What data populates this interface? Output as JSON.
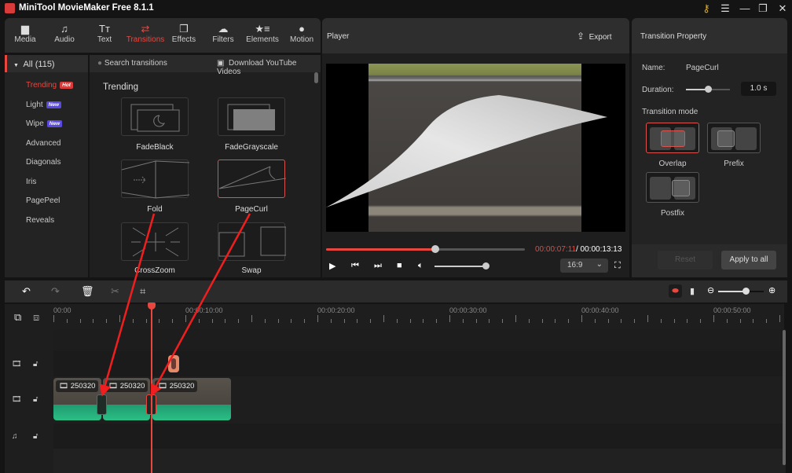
{
  "app": {
    "title": "MiniTool MovieMaker Free 8.1.1"
  },
  "window_controls": [
    {
      "name": "key-icon",
      "glyph": "⚷"
    },
    {
      "name": "menu-icon",
      "glyph": "☰"
    },
    {
      "name": "minimize-icon",
      "glyph": "—"
    },
    {
      "name": "restore-icon",
      "glyph": "❐"
    },
    {
      "name": "close-icon",
      "glyph": "✕"
    }
  ],
  "toolbar": {
    "tabs": [
      {
        "label": "Media",
        "icon": "folder-icon",
        "glyph": "▆"
      },
      {
        "label": "Audio",
        "icon": "music-icon",
        "glyph": "♫"
      },
      {
        "label": "Text",
        "icon": "text-icon",
        "glyph": "Tт"
      },
      {
        "label": "Transitions",
        "icon": "transitions-icon",
        "glyph": "⇄",
        "active": true
      },
      {
        "label": "Effects",
        "icon": "effects-icon",
        "glyph": "❐"
      },
      {
        "label": "Filters",
        "icon": "filters-icon",
        "glyph": "☁"
      },
      {
        "label": "Elements",
        "icon": "elements-icon",
        "glyph": "★≡"
      },
      {
        "label": "Motion",
        "icon": "motion-icon",
        "glyph": "●"
      }
    ]
  },
  "categories": {
    "all_label": "All (115)",
    "items": [
      {
        "label": "Trending",
        "badge": "Hot",
        "active": true
      },
      {
        "label": "Light",
        "badge": "New"
      },
      {
        "label": "Wipe",
        "badge": "New"
      },
      {
        "label": "Advanced"
      },
      {
        "label": "Diagonals"
      },
      {
        "label": "Iris"
      },
      {
        "label": "PagePeel"
      },
      {
        "label": "Reveals"
      }
    ]
  },
  "library": {
    "search_placeholder": "Search transitions",
    "download_label": "Download YouTube Videos",
    "section_title": "Trending",
    "items": [
      {
        "label": "FadeBlack"
      },
      {
        "label": "FadeGrayscale"
      },
      {
        "label": "Fold"
      },
      {
        "label": "PageCurl",
        "selected": true
      },
      {
        "label": "CrossZoom"
      },
      {
        "label": "Swap"
      }
    ]
  },
  "player": {
    "title": "Player",
    "export_label": "Export",
    "current_time": "00:00:07:11",
    "total_time": "/ 00:00:13:13",
    "progress_fraction": 0.55,
    "volume_fraction": 1.0,
    "aspect_ratio": "16:9"
  },
  "property": {
    "title": "Transition Property",
    "name_label": "Name:",
    "name_value": "PageCurl",
    "duration_label": "Duration:",
    "duration_value": "1.0 s",
    "duration_fraction": 0.5,
    "mode_label": "Transition mode",
    "modes": [
      {
        "label": "Overlap",
        "selected": true
      },
      {
        "label": "Prefix"
      },
      {
        "label": "Postfix"
      }
    ],
    "reset_label": "Reset",
    "apply_label": "Apply to all"
  },
  "timeline": {
    "ruler_labels": [
      "00:00",
      "00:00:10:00",
      "00:00:20:00",
      "00:00:30:00",
      "00:00:40:00",
      "00:00:50:00"
    ],
    "clips": [
      {
        "label": "250320"
      },
      {
        "label": "250320"
      },
      {
        "label": "250320"
      }
    ],
    "zoom_fraction": 0.6
  }
}
